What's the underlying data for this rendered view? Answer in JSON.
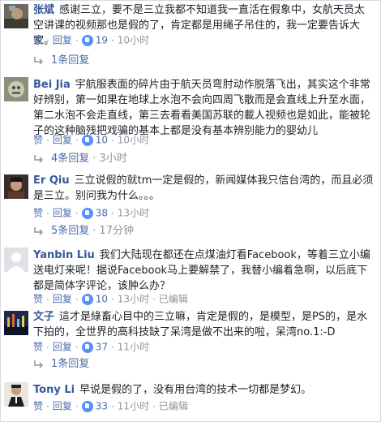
{
  "comments": [
    {
      "author": "张斌",
      "text": "感谢三立，要不是三立我都不知道我一直活在假象中，女航天员太空讲课的视频那也是假的了，肯定都是用绳子吊住的，我一定要告诉大家。",
      "like_label": "赞",
      "reply_label": "回复",
      "likes": "19",
      "time": "10小时",
      "replies": "1条回复"
    },
    {
      "author": "Bei Jia",
      "text": "宇航服表面的碎片由于航天员弯肘动作脱落飞出，其实这个非常好辨别，第一如果在地球上水泡不会向四周飞散而是会直线上升至水面，第二水泡不会走直线，第三去看看美国苏联的載人视频也是如此，能被轮子的这种脑残把戏骗的基本上都是没有基本辨别能力的婴幼儿",
      "like_label": "赞",
      "reply_label": "回复",
      "likes": "10",
      "time": "10小时",
      "replies": "4条回复",
      "reply_time": "3小时"
    },
    {
      "author": "Er Qiu",
      "text": "三立说假的就tm一定是假的，新闻媒体我只信台湾的，而且必须是三立。别问我为什么。。。",
      "like_label": "赞",
      "reply_label": "回复",
      "likes": "38",
      "time": "13小时",
      "replies": "5条回复",
      "reply_time": "17分钟"
    },
    {
      "author": "Yanbin Liu",
      "text": "我们大陆现在都还在点煤油灯看Facebook，等着三立小编送电灯来呢！据说Facebook马上要解禁了，我替小编着急啊，以后底下都是简体字评论，该肿么办？",
      "like_label": "赞",
      "reply_label": "回复",
      "likes": "10",
      "time": "13小时",
      "edited": "已编辑"
    },
    {
      "author": "文子",
      "text": "這才是綠畜心目中的三立嘛，肯定是假的，是模型，是PS的，是水下拍的，全世界的高科技缺了呆湾是做不出来的啦，呆湾no.1:-D",
      "like_label": "赞",
      "reply_label": "回复",
      "likes": "37",
      "time": "11小时",
      "replies": "1条回复"
    },
    {
      "author": "Tony Li",
      "text": "早说是假的了，没有用台湾的技术一切都是梦幻。",
      "like_label": "赞",
      "reply_label": "回复",
      "likes": "33",
      "time": "11小时",
      "edited": "已编辑"
    }
  ]
}
